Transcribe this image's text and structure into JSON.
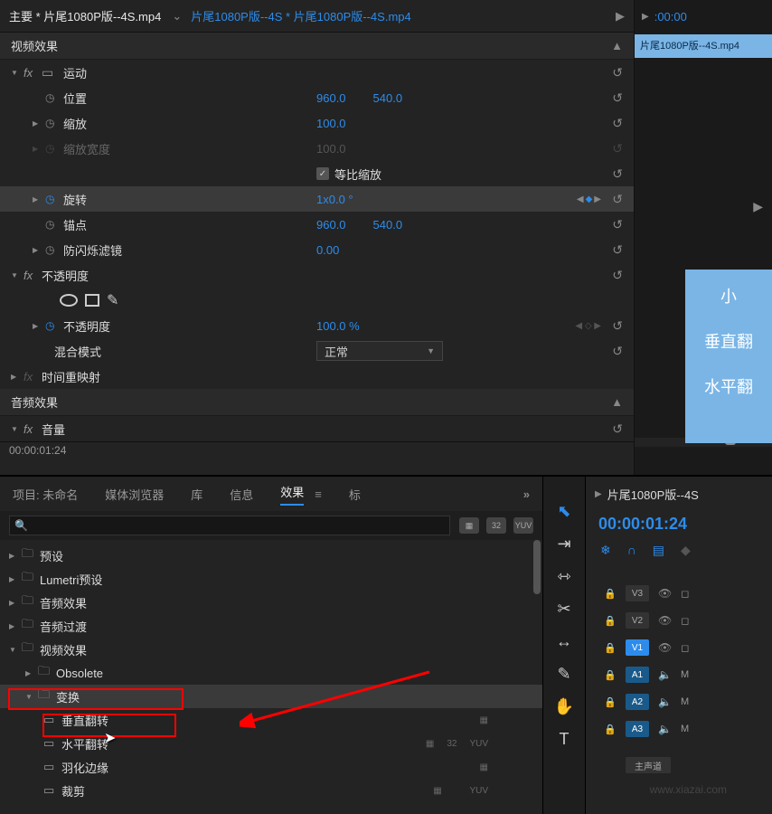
{
  "header": {
    "main_tab": "主要 * 片尾1080P版--4S.mp4",
    "breadcrumb": "片尾1080P版--4S * 片尾1080P版--4S.mp4",
    "ruler_start": ":00:00"
  },
  "sections": {
    "video_effects": "视频效果",
    "audio_effects": "音频效果"
  },
  "motion": {
    "title": "运动",
    "position": {
      "label": "位置",
      "x": "960.0",
      "y": "540.0"
    },
    "scale": {
      "label": "缩放",
      "value": "100.0"
    },
    "scale_width": {
      "label": "缩放宽度",
      "value": "100.0"
    },
    "uniform": {
      "label": "等比缩放"
    },
    "rotation": {
      "label": "旋转",
      "value": "1x0.0 °"
    },
    "anchor": {
      "label": "锚点",
      "x": "960.0",
      "y": "540.0"
    },
    "antiflicker": {
      "label": "防闪烁滤镜",
      "value": "0.00"
    }
  },
  "opacity": {
    "title": "不透明度",
    "opacity": {
      "label": "不透明度",
      "value": "100.0 %"
    },
    "blend": {
      "label": "混合模式",
      "value": "正常"
    }
  },
  "time_remap": "时间重映射",
  "volume": "音量",
  "timecode": "00:00:01:24",
  "timeline_clip": "片尾1080P版--4S.mp4",
  "effects_browser": {
    "tabs": {
      "project": "项目: 未命名",
      "media_browser": "媒体浏览器",
      "library": "库",
      "info": "信息",
      "effects": "效果",
      "markers": "标"
    },
    "tree": {
      "presets": "预设",
      "lumetri": "Lumetri预设",
      "audio_fx": "音频效果",
      "audio_trans": "音频过渡",
      "video_fx": "视频效果",
      "obsolete": "Obsolete",
      "transform": "变换",
      "vflip": "垂直翻转",
      "hflip": "水平翻转",
      "feather": "羽化边缘",
      "crop": "裁剪"
    }
  },
  "timeline_panel": {
    "sequence": "片尾1080P版--4S",
    "timecode": "00:00:01:24",
    "tracks": {
      "v3": "V3",
      "v2": "V2",
      "v1": "V1",
      "a1": "A1",
      "a2": "A2",
      "a3": "A3"
    },
    "master": "主声道"
  },
  "overlay": {
    "line1": "小",
    "line2": "垂直翻",
    "line3": "水平翻"
  },
  "watermark": "www.xiazai.com"
}
